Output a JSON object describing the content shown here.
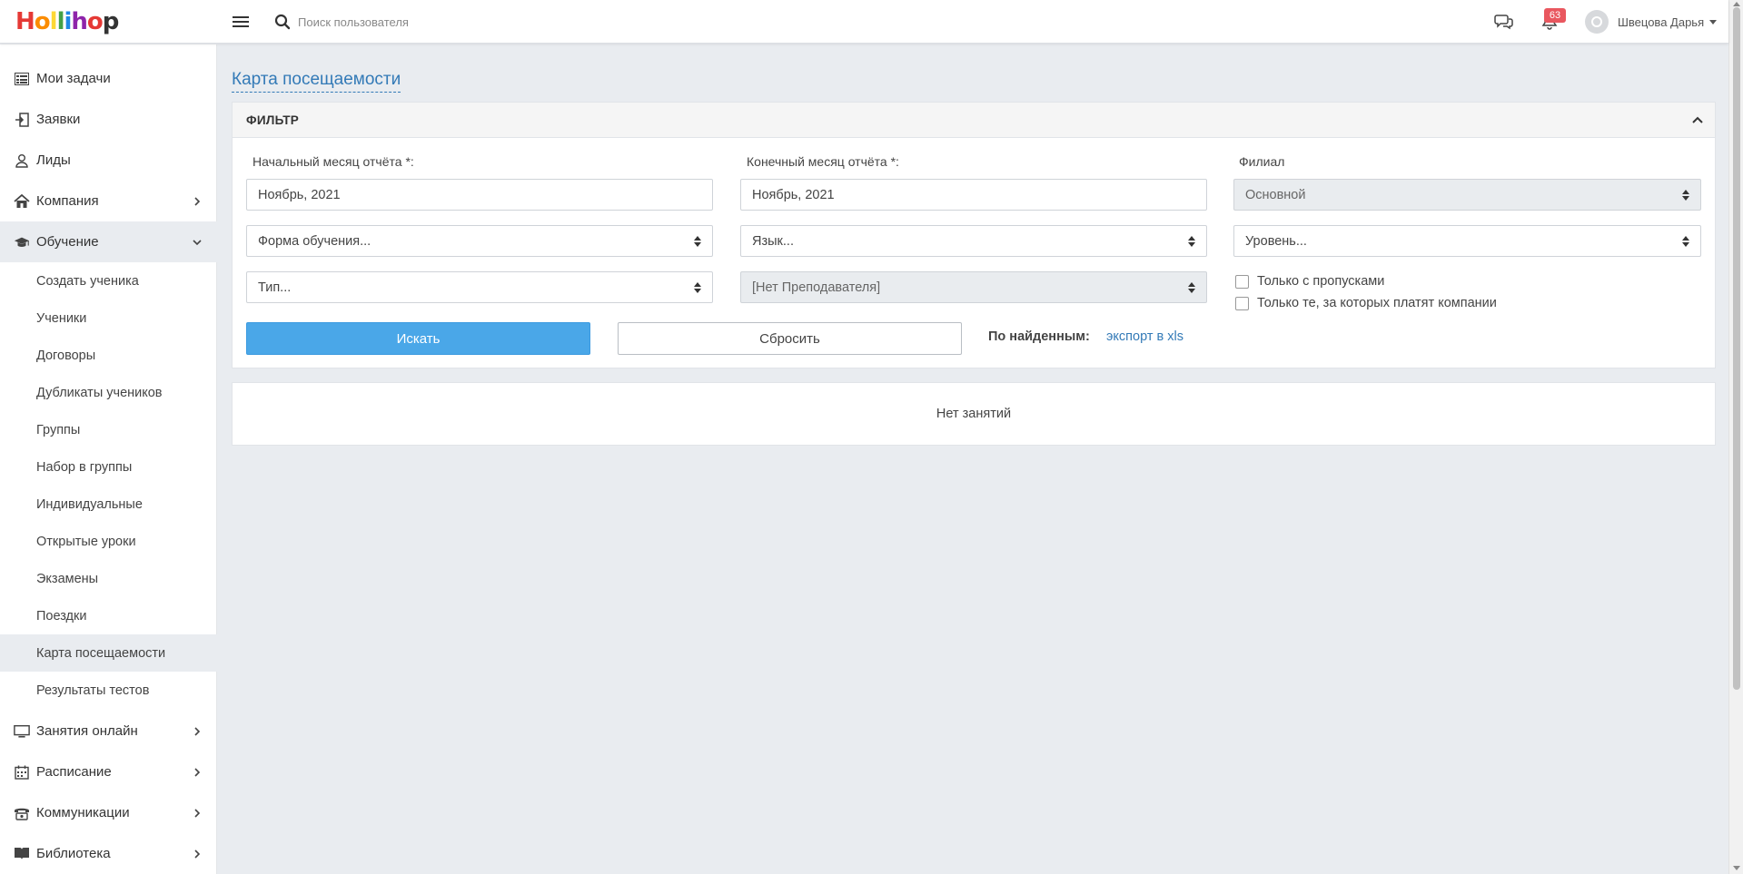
{
  "app": {
    "logo_letters": [
      "H",
      "o",
      "l",
      "l",
      "i",
      "h",
      "o",
      "p"
    ],
    "logo_text": "Hollihop"
  },
  "header": {
    "search_placeholder": "Поиск пользователя",
    "notifications_count": "63",
    "user_name": "Швецова Дарья"
  },
  "sidebar": {
    "items": [
      {
        "label": "Мои задачи",
        "icon": "tasks-list-icon"
      },
      {
        "label": "Заявки",
        "icon": "sign-in-icon"
      },
      {
        "label": "Лиды",
        "icon": "user-icon"
      },
      {
        "label": "Компания",
        "icon": "home-icon"
      },
      {
        "label": "Обучение",
        "icon": "graduation-cap-icon"
      }
    ],
    "subitems": [
      {
        "label": "Создать ученика"
      },
      {
        "label": "Ученики"
      },
      {
        "label": "Договоры"
      },
      {
        "label": "Дубликаты учеников"
      },
      {
        "label": "Группы"
      },
      {
        "label": "Набор в группы"
      },
      {
        "label": "Индивидуальные"
      },
      {
        "label": "Открытые уроки"
      },
      {
        "label": "Экзамены"
      },
      {
        "label": "Поездки"
      },
      {
        "label": "Карта посещаемости"
      },
      {
        "label": "Результаты тестов"
      }
    ],
    "bottom_items": [
      {
        "label": "Занятия онлайн",
        "icon": "monitor-icon"
      },
      {
        "label": "Расписание",
        "icon": "calendar-icon"
      },
      {
        "label": "Коммуникации",
        "icon": "phone-icon"
      },
      {
        "label": "Библиотека",
        "icon": "book-icon"
      }
    ],
    "active_subitem": "Карта посещаемости"
  },
  "main": {
    "title": "Карта посещаемости",
    "filter": {
      "heading": "ФИЛЬТР",
      "start_month_label": "Начальный месяц отчёта *:",
      "start_month_value": "Ноябрь, 2021",
      "end_month_label": "Конечный месяц отчёта *:",
      "end_month_value": "Ноябрь, 2021",
      "branch_label": "Филиал",
      "branch_value": "Основной",
      "form_placeholder": "Форма обучения...",
      "language_placeholder": "Язык...",
      "level_placeholder": "Уровень...",
      "type_placeholder": "Тип...",
      "teacher_value": "[Нет Преподавателя]",
      "only_absences_label": "Только с пропусками",
      "only_company_paid_label": "Только те, за которых платят компании",
      "search_button": "Искать",
      "reset_button": "Сбросить",
      "found_label": "По найденным:",
      "export_link": "экспорт в xls"
    },
    "results_empty_text": "Нет занятий"
  },
  "colors": {
    "primary": "#4aa7e8",
    "link": "#337ab7",
    "badge": "#e9575f",
    "background": "#e9ecf0"
  }
}
